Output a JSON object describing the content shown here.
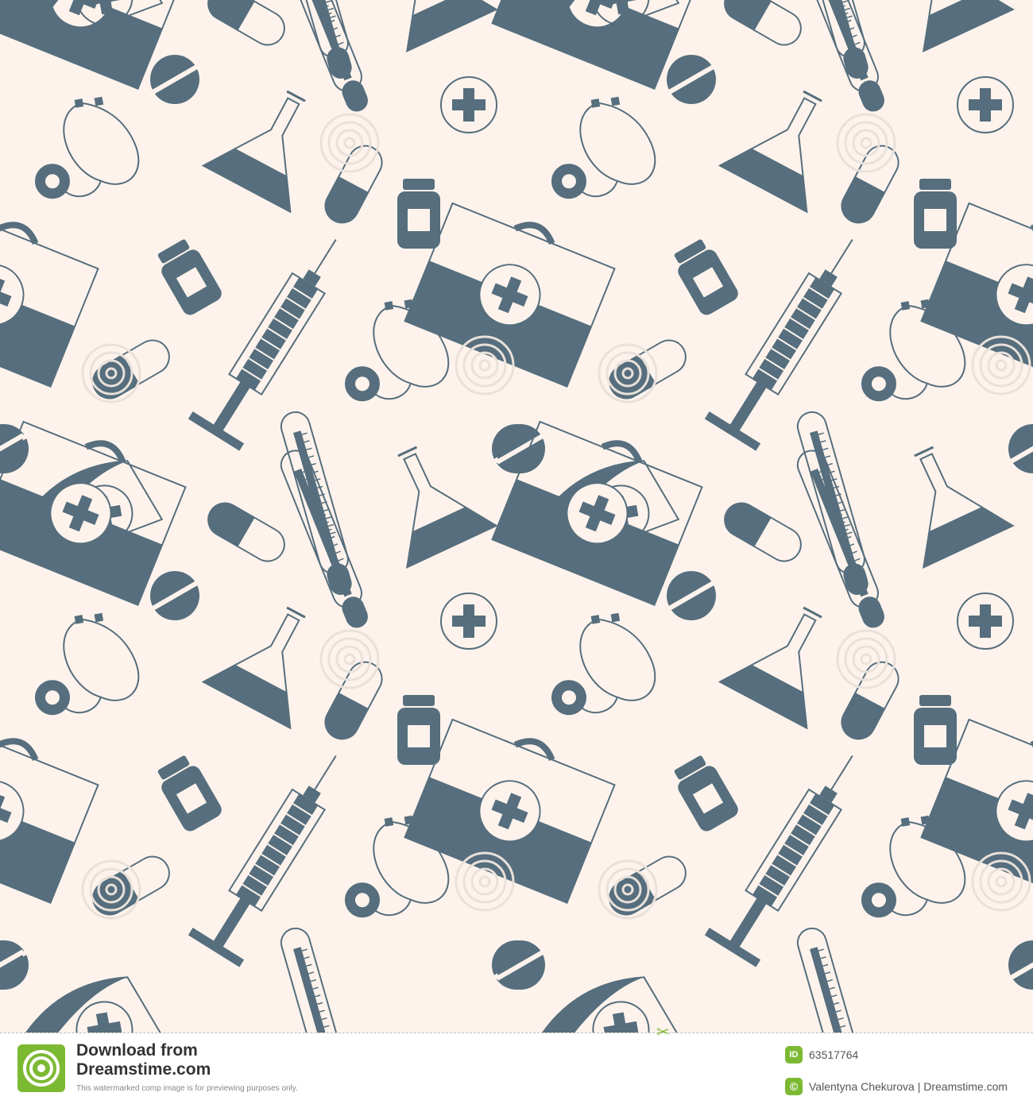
{
  "image": {
    "description_colors": {
      "background": "#fdf3ec",
      "icon": "#566e7d",
      "watermark": "#e9e1da",
      "accent": "#7cb933"
    },
    "watermark_text": "dreamstime"
  },
  "footer": {
    "download_line": "Download from",
    "site": "Dreamstime.com",
    "note": "This watermarked comp image is for previewing purposes only.",
    "id_badge": "ID",
    "image_id": "63517764",
    "copyright_badge": "©",
    "author": "Valentyna Chekurova | Dreamstime.com",
    "logo_icon": "dreamstime-spiral-logo-icon",
    "scissors_icon": "scissors-icon"
  }
}
